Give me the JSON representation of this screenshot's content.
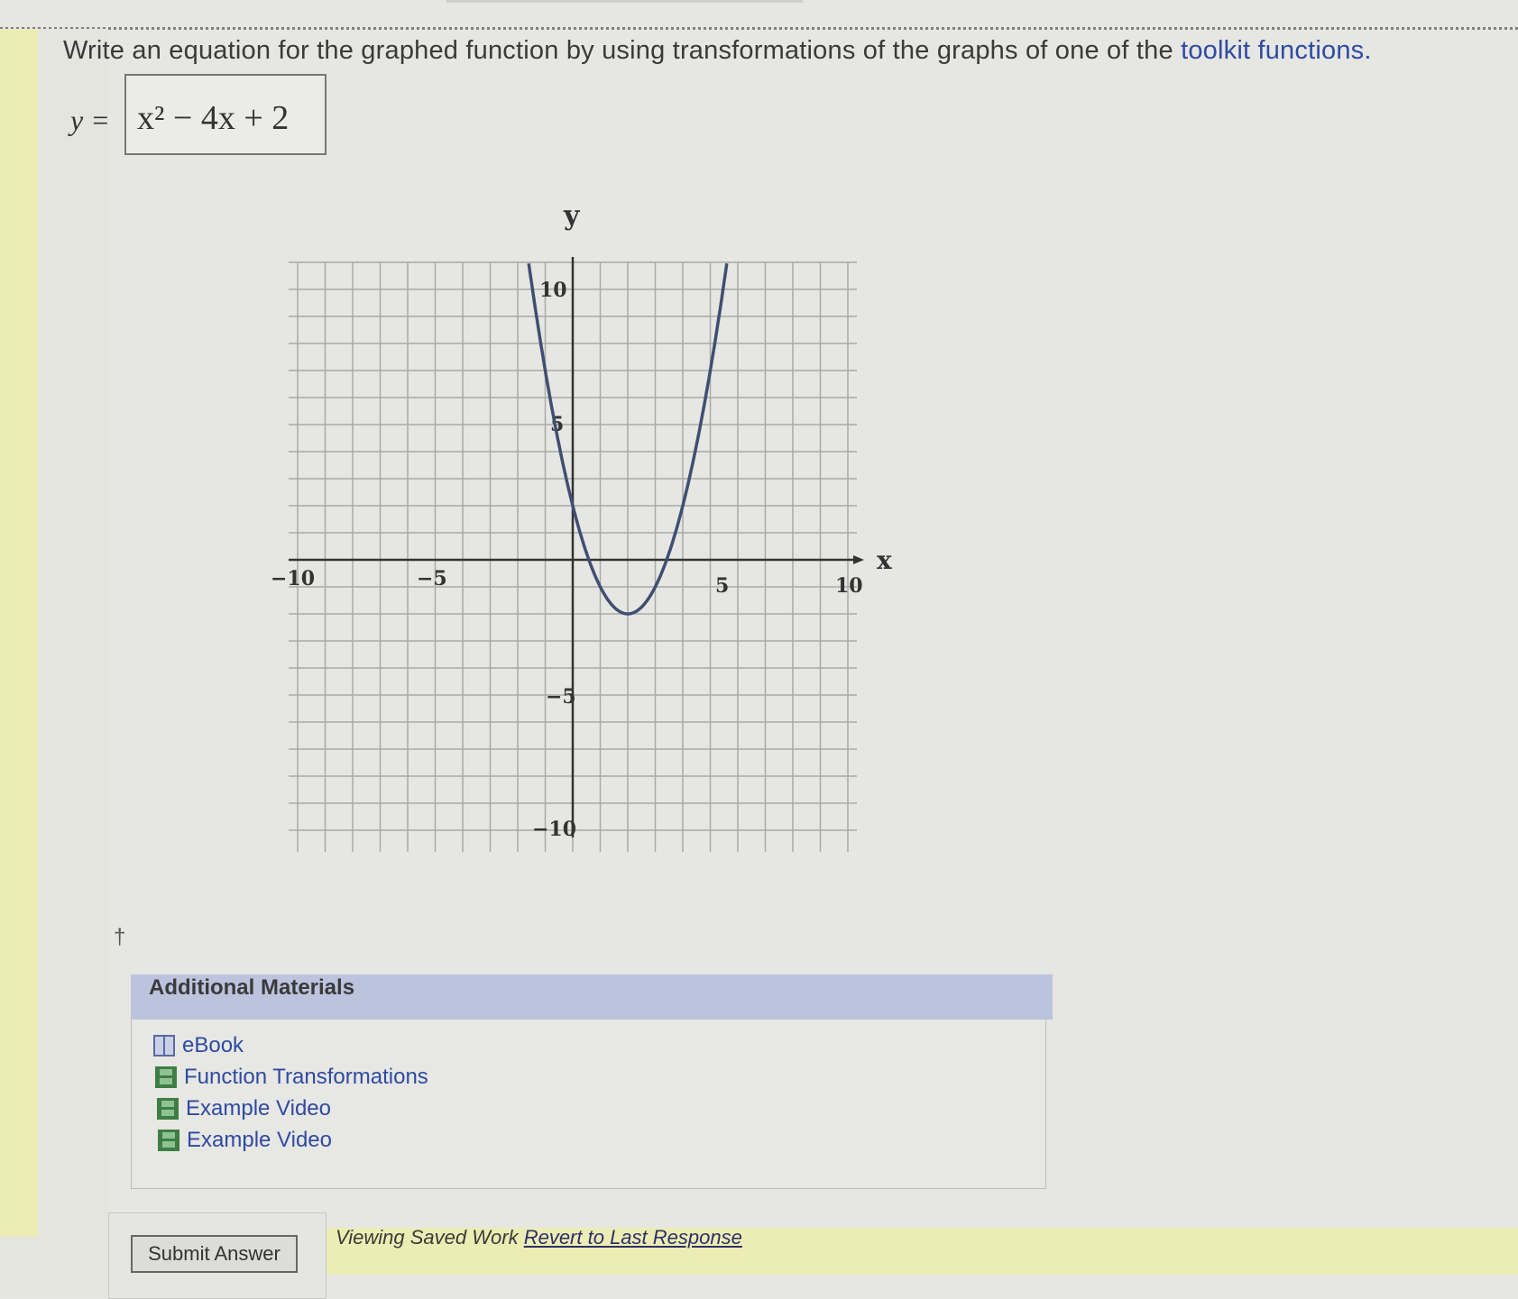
{
  "question": {
    "text": "Write an equation for the graphed function by using transformations of the graphs of one of the",
    "link": "toolkit functions."
  },
  "answer": {
    "prefix": "y =",
    "value": "x² − 4x + 2"
  },
  "graph": {
    "y_axis_label": "y",
    "x_axis_label": "x",
    "x_ticks": [
      "−10",
      "−5",
      "5",
      "10"
    ],
    "y_ticks": [
      "10",
      "5",
      "−5",
      "−10"
    ]
  },
  "chart_data": {
    "type": "line",
    "xlim": [
      -10,
      10
    ],
    "ylim": [
      -10,
      10
    ],
    "xlabel": "x",
    "ylabel": "y",
    "grid": true,
    "series": [
      {
        "function": "x^2 - 4x + 2",
        "color": "#3f4f72"
      }
    ]
  },
  "dagger": "†",
  "materials": {
    "title": "Additional Materials",
    "items": [
      {
        "label": "eBook",
        "icon": "book-icon"
      },
      {
        "label": "Function Transformations",
        "icon": "film-icon"
      },
      {
        "label": "Example Video",
        "icon": "film-icon"
      },
      {
        "label": "Example Video",
        "icon": "film-icon"
      }
    ]
  },
  "submit": {
    "label": "Submit Answer"
  },
  "saved": {
    "text": "Viewing Saved Work",
    "revert": "Revert to Last Response"
  }
}
